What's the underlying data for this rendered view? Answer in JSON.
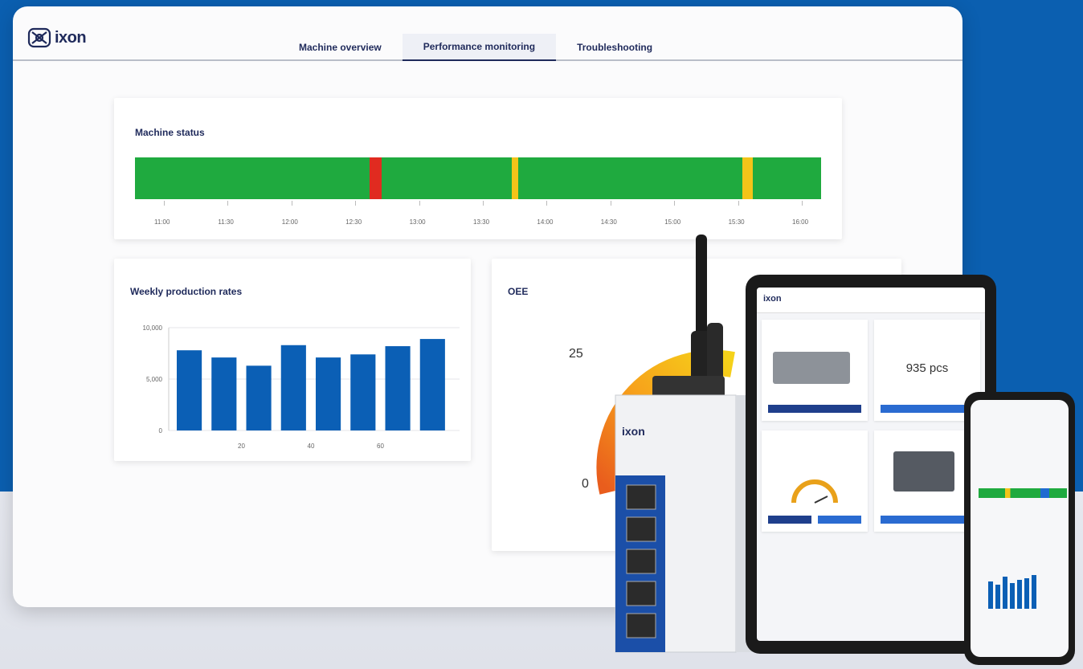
{
  "app": {
    "name": "ixon"
  },
  "tabs": [
    {
      "label": "Machine overview"
    },
    {
      "label": "Performance monitoring"
    },
    {
      "label": "Troubleshooting"
    }
  ],
  "machine_status": {
    "title": "Machine status",
    "colors": {
      "running": "#1faa3f",
      "stopped": "#e02b20",
      "warning": "#f3c419"
    },
    "segments": [
      {
        "state": "running",
        "fraction": 0.342
      },
      {
        "state": "stopped",
        "fraction": 0.018
      },
      {
        "state": "running",
        "fraction": 0.189
      },
      {
        "state": "warning",
        "fraction": 0.01
      },
      {
        "state": "running",
        "fraction": 0.326
      },
      {
        "state": "warning",
        "fraction": 0.016
      },
      {
        "state": "running",
        "fraction": 0.099
      }
    ],
    "times": [
      "11:00",
      "11:30",
      "12:00",
      "12:30",
      "13:00",
      "13:30",
      "14:00",
      "14:30",
      "15:00",
      "15:30",
      "16:00"
    ]
  },
  "weekly": {
    "title": "Weekly production rates",
    "chart_data": {
      "type": "bar",
      "ylim": [
        0,
        10000
      ],
      "y_ticks": [
        {
          "value": 10000,
          "label": "10,000"
        },
        {
          "value": 5000,
          "label": "5,000"
        },
        {
          "value": 0,
          "label": "0"
        }
      ],
      "x_ticks": [
        "20",
        "40",
        "60"
      ],
      "color": "#0b5fb5",
      "values": [
        7800,
        7100,
        6300,
        8300,
        7100,
        7400,
        8200,
        8900
      ]
    }
  },
  "oee": {
    "title": "OEE",
    "label_25": "25",
    "label_0": "0"
  },
  "tablet": {
    "logo": "ixon",
    "value": "935 pcs"
  }
}
